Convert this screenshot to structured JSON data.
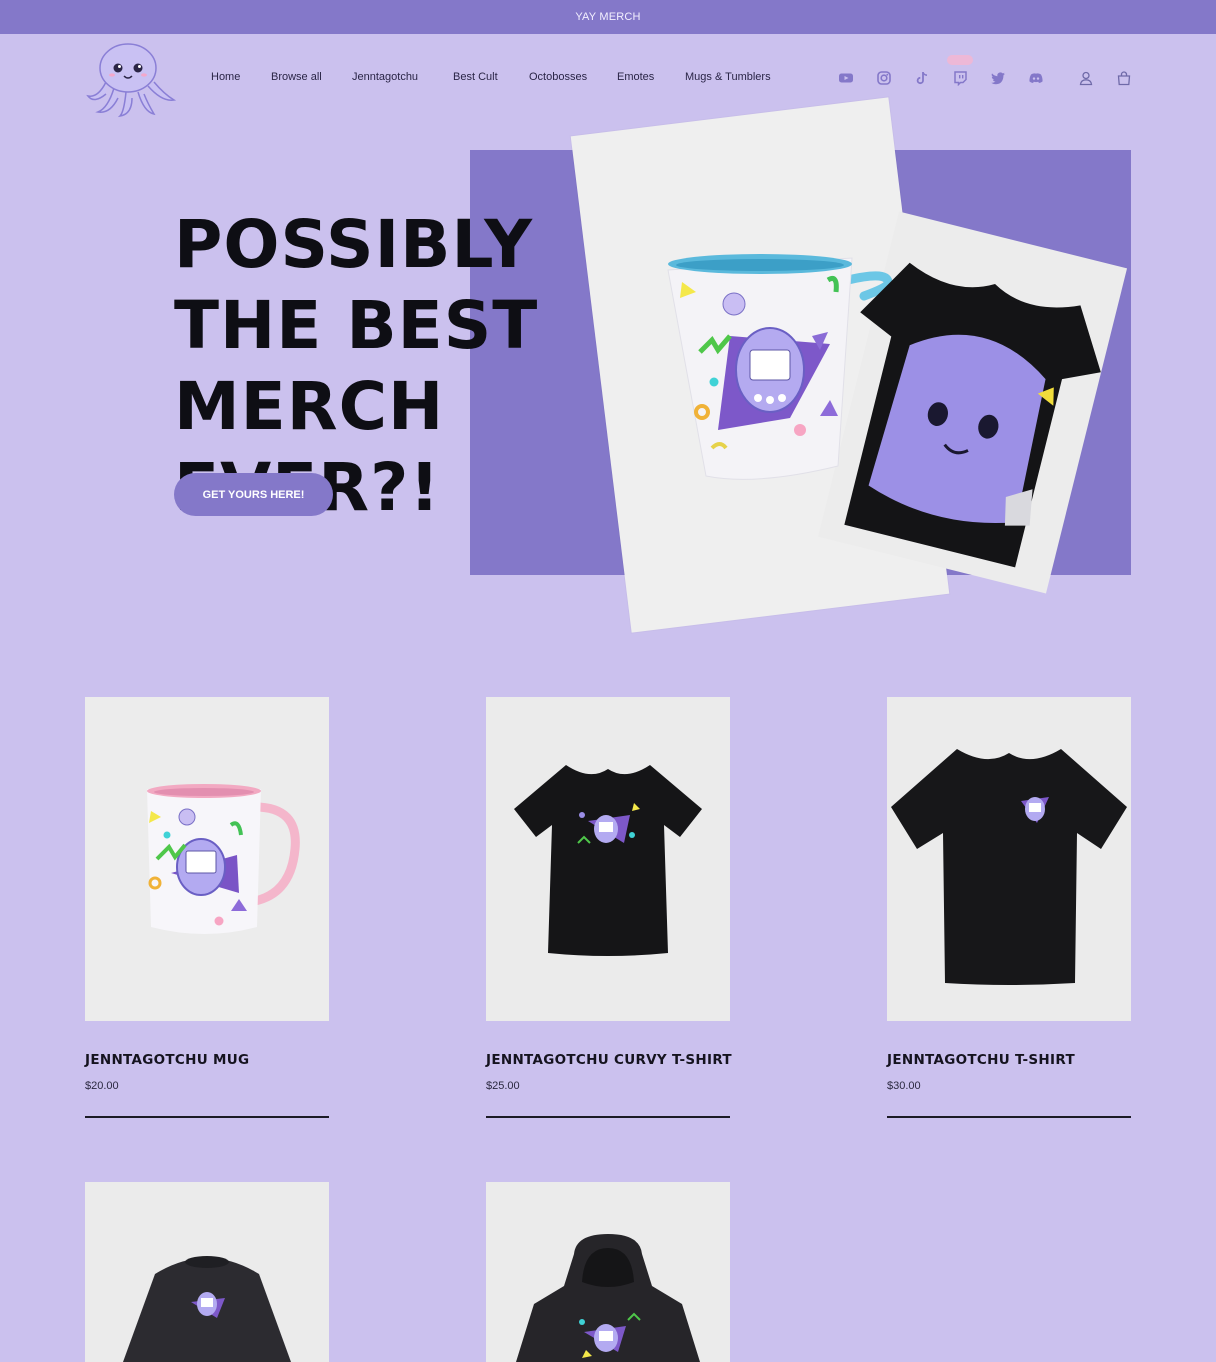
{
  "announcement": "YAY MERCH",
  "nav": {
    "items": [
      "Home",
      "Browse all",
      "Jenntagotchu",
      "Best Cult",
      "Octobosses",
      "Emotes",
      "Mugs & Tumblers"
    ]
  },
  "social": [
    "youtube-icon",
    "instagram-icon",
    "tiktok-icon",
    "twitch-icon",
    "twitter-icon",
    "discord-icon"
  ],
  "account": [
    "account-icon",
    "cart-icon"
  ],
  "hero": {
    "title": "POSSIBLY THE BEST MERCH EVER?!",
    "cta": "GET YOURS HERE!"
  },
  "products": [
    {
      "name": "JENNTAGOTCHU MUG",
      "price": "$20.00"
    },
    {
      "name": "JENNTAGOTCHU CURVY T-SHIRT",
      "price": "$25.00"
    },
    {
      "name": "JENNTAGOTCHU T-SHIRT",
      "price": "$30.00"
    }
  ],
  "colors": {
    "background": "#cbc1ee",
    "accent": "#8478c9",
    "text": "#0e0e14"
  }
}
